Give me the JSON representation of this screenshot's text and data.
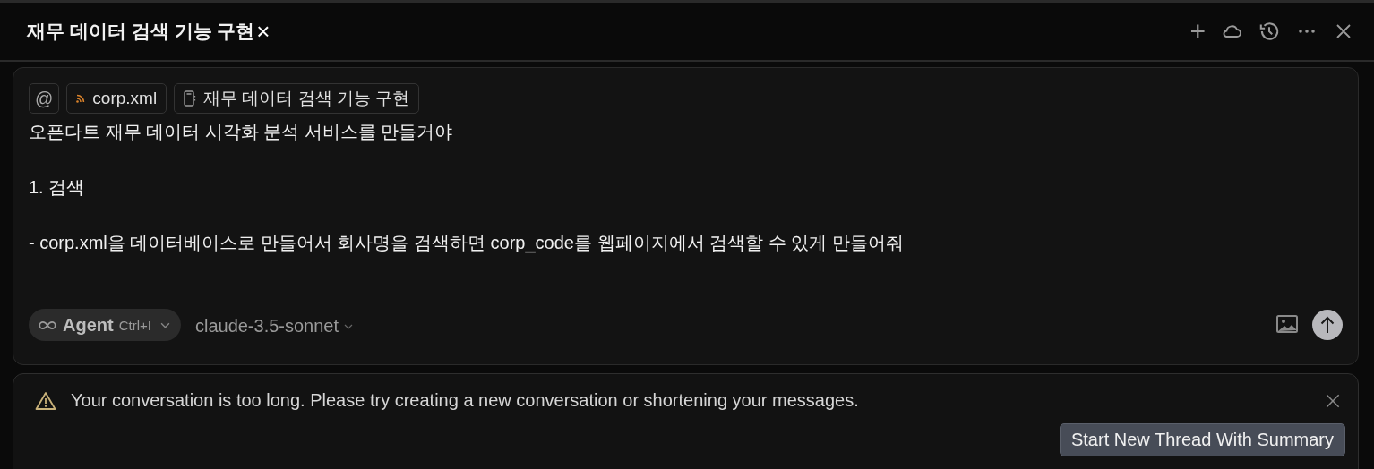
{
  "tab": {
    "title": "재무 데이터 검색 기능 구현",
    "close": "×"
  },
  "toolbar": [
    {
      "kind": "add",
      "label": "+"
    },
    {
      "kind": "cloud"
    },
    {
      "kind": "history"
    },
    {
      "kind": "more"
    },
    {
      "kind": "close"
    }
  ],
  "composer": {
    "chips": [
      {
        "kind": "mention",
        "label": "@"
      },
      {
        "kind": "file",
        "label": "corp.xml"
      },
      {
        "kind": "doc",
        "label": "재무 데이터 검색 기능 구현"
      }
    ],
    "lines": [
      "오픈다트 재무 데이터 시각화 분석 서비스를 만들거야",
      "1. 검색",
      "- corp.xml을 데이터베이스로 만들어서 회사명을 검색하면 corp_code를 웹페이지에서 검색할 수 있게 만들어줘"
    ],
    "mode": {
      "label": "Agent",
      "shortcut": "Ctrl+I"
    },
    "model": "claude-3.5-sonnet"
  },
  "warning": {
    "message": "Your conversation is too long. Please try creating a new conversation or shortening your messages.",
    "action": "Start New Thread With Summary"
  }
}
